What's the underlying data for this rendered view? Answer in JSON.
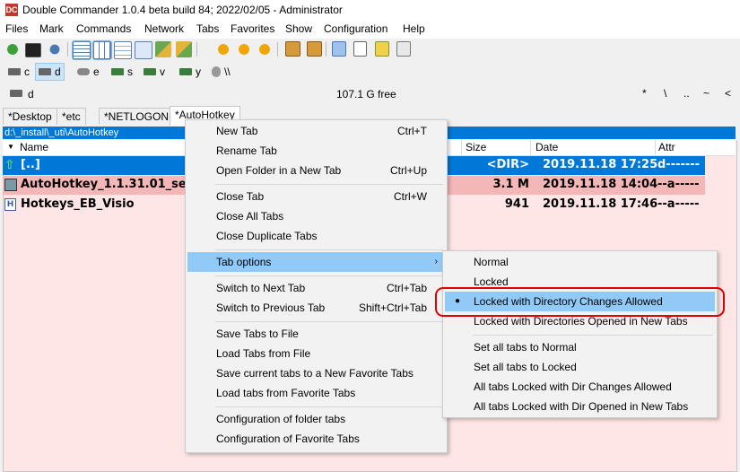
{
  "window": {
    "title": "Double Commander 1.0.4 beta build 84; 2022/02/05 - Administrator",
    "logo_text": "DC"
  },
  "menubar": [
    "Files",
    "Mark",
    "Commands",
    "Network",
    "Tabs",
    "Favorites",
    "Show",
    "Configuration",
    "Help"
  ],
  "toolbar_icons": [
    "refresh-icon",
    "terminal-icon",
    "options-icon",
    "brief-view-icon",
    "columns-view-icon",
    "thumbnail-view-icon",
    "flat-view-icon",
    "copy-path-icon",
    "move-path-icon",
    "multi-rename-icon",
    "sync-dirs-icon",
    "search-icon",
    "compare-icon",
    "pack-icon",
    "unpack-icon",
    "copy-names-icon",
    "edit-icon",
    "notepad-icon",
    "about-icon"
  ],
  "drives": [
    {
      "letter": "c",
      "icon": "drive-icon"
    },
    {
      "letter": "d",
      "icon": "drive-icon"
    },
    {
      "letter": "e",
      "icon": "network-drive-icon"
    },
    {
      "letter": "s",
      "icon": "network-drive-icon"
    },
    {
      "letter": "v",
      "icon": "network-drive-icon"
    },
    {
      "letter": "y",
      "icon": "network-drive-icon"
    },
    {
      "letter": "\\\\",
      "icon": "network-icon"
    }
  ],
  "infobar": {
    "drive": "d",
    "free": "107.1 G free",
    "buttons": [
      "*",
      "\\",
      "..",
      "~",
      "<"
    ]
  },
  "tabs": [
    "*Desktop",
    "*etc",
    "*NETLOGON",
    "*AutoHotkey"
  ],
  "path": "d:\\_install\\_uti\\AutoHotkey",
  "columns": {
    "name": "Name",
    "size": "Size",
    "date": "Date",
    "attr": "Attr"
  },
  "files": [
    {
      "name": "[..]",
      "size": "<DIR>",
      "date": "2019.11.18 17:25",
      "attr": "d-------",
      "icon": "up-arrow-icon",
      "style": "selected"
    },
    {
      "name": "AutoHotkey_1.1.31.01_set",
      "size": "3.1 M",
      "date": "2019.11.18 14:04",
      "attr": "--a-----",
      "icon": "installer-icon",
      "style": "marked"
    },
    {
      "name": "Hotkeys_EB_Visio",
      "size": "941",
      "date": "2019.11.18 17:46",
      "attr": "--a-----",
      "icon": "text-file-icon",
      "style": "normal"
    }
  ],
  "context_menu": {
    "items": [
      {
        "label": "New Tab",
        "shortcut": "Ctrl+T"
      },
      {
        "label": "Rename Tab",
        "shortcut": ""
      },
      {
        "label": "Open Folder in a New Tab",
        "shortcut": "Ctrl+Up"
      },
      {
        "label": "Close Tab",
        "shortcut": "Ctrl+W"
      },
      {
        "label": "Close All Tabs",
        "shortcut": ""
      },
      {
        "label": "Close Duplicate Tabs",
        "shortcut": ""
      },
      {
        "label": "Tab options",
        "shortcut": ""
      },
      {
        "label": "Switch to Next Tab",
        "shortcut": "Ctrl+Tab"
      },
      {
        "label": "Switch to Previous Tab",
        "shortcut": "Shift+Ctrl+Tab"
      },
      {
        "label": "Save Tabs to File",
        "shortcut": ""
      },
      {
        "label": "Load Tabs from File",
        "shortcut": ""
      },
      {
        "label": "Save current tabs to a New Favorite Tabs",
        "shortcut": ""
      },
      {
        "label": "Load tabs from Favorite Tabs",
        "shortcut": ""
      },
      {
        "label": "Configuration of folder tabs",
        "shortcut": ""
      },
      {
        "label": "Configuration of Favorite Tabs",
        "shortcut": ""
      }
    ]
  },
  "submenu": {
    "items": [
      "Normal",
      "Locked",
      "Locked with Directory Changes Allowed",
      "Locked with Directories Opened in New Tabs",
      "Set all tabs to Normal",
      "Set all tabs to Locked",
      "All tabs Locked with Dir Changes Allowed",
      "All tabs Locked with Dir Opened in New Tabs"
    ],
    "checked": "Locked with Directory Changes Allowed"
  },
  "colors": {
    "selection": "#0078d7",
    "marked_row": "#f4b7b7",
    "panel_bg": "#ffe6e6",
    "menu_highlight": "#91c9f7",
    "annotation_ring": "#e00000"
  }
}
